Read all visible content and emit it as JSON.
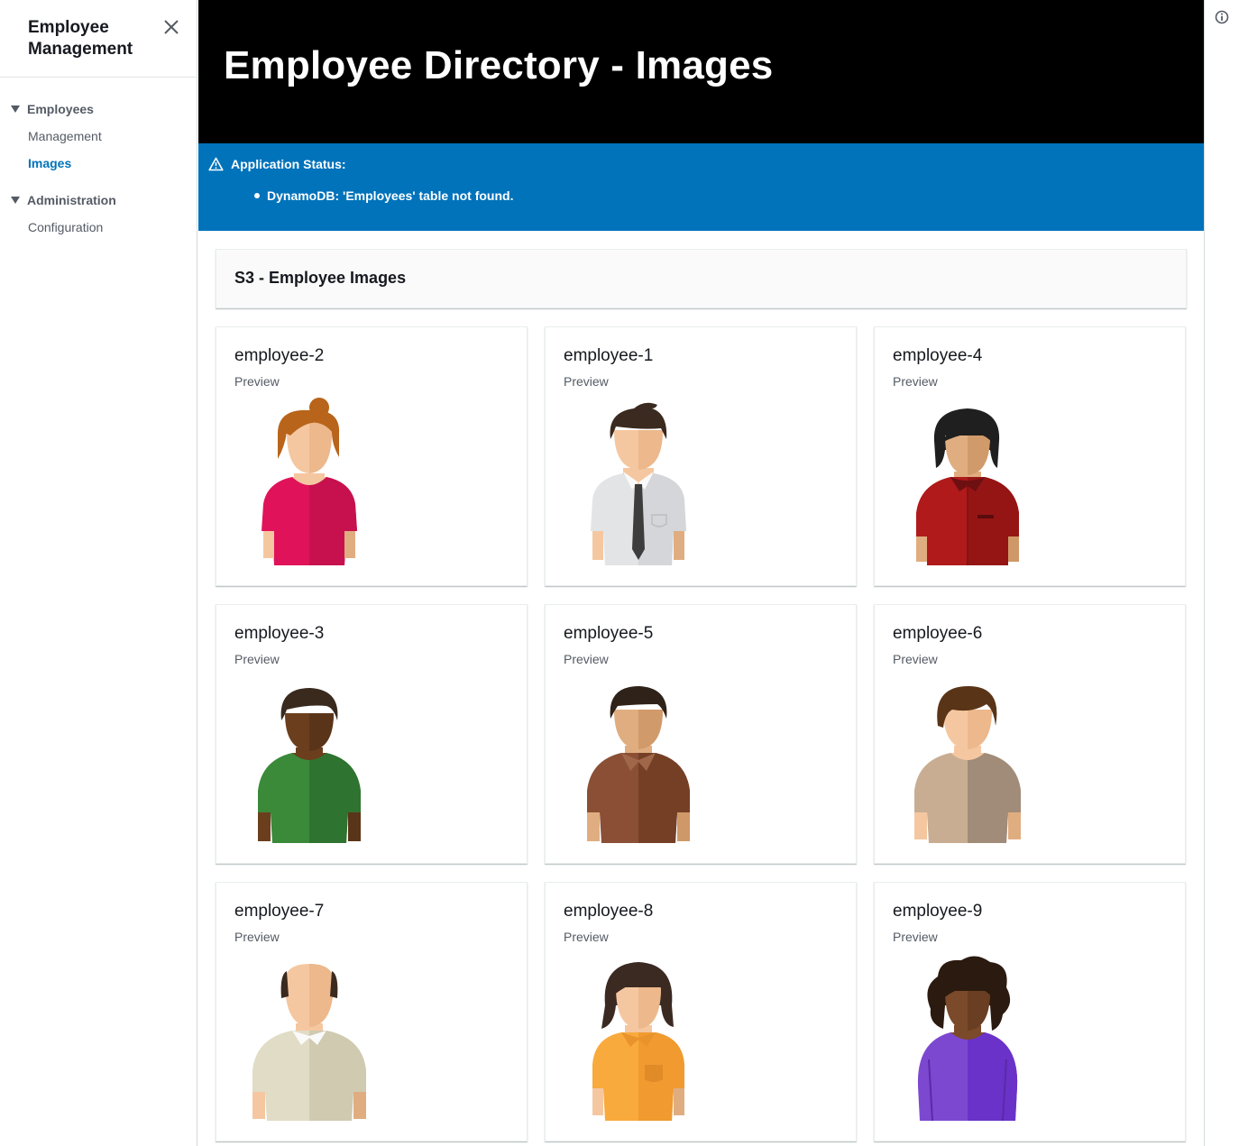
{
  "sidebar": {
    "title": "Employee Management",
    "sections": [
      {
        "label": "Employees",
        "links": [
          {
            "label": "Management",
            "active": false
          },
          {
            "label": "Images",
            "active": true
          }
        ]
      },
      {
        "label": "Administration",
        "links": [
          {
            "label": "Configuration",
            "active": false
          }
        ]
      }
    ]
  },
  "header": {
    "title": "Employee Directory - Images"
  },
  "flash": {
    "title": "Application Status:",
    "items": [
      "DynamoDB: 'Employees' table not found."
    ]
  },
  "panel": {
    "title": "S3 - Employee Images"
  },
  "cards": [
    {
      "name": "employee-2",
      "sub": "Preview",
      "avatar": "woman-bun-pink-shirt"
    },
    {
      "name": "employee-1",
      "sub": "Preview",
      "avatar": "man-tie-grey-shirt"
    },
    {
      "name": "employee-4",
      "sub": "Preview",
      "avatar": "woman-black-hair-red-shirt"
    },
    {
      "name": "employee-3",
      "sub": "Preview",
      "avatar": "man-green-shirt"
    },
    {
      "name": "employee-5",
      "sub": "Preview",
      "avatar": "man-brown-shirt"
    },
    {
      "name": "employee-6",
      "sub": "Preview",
      "avatar": "man-beige-shirt"
    },
    {
      "name": "employee-7",
      "sub": "Preview",
      "avatar": "bald-man-cream-shirt"
    },
    {
      "name": "employee-8",
      "sub": "Preview",
      "avatar": "woman-orange-shirt"
    },
    {
      "name": "employee-9",
      "sub": "Preview",
      "avatar": "woman-curly-hair-purple-shirt"
    }
  ],
  "colors": {
    "accent": "#0073bb",
    "hero_bg": "#000000"
  }
}
